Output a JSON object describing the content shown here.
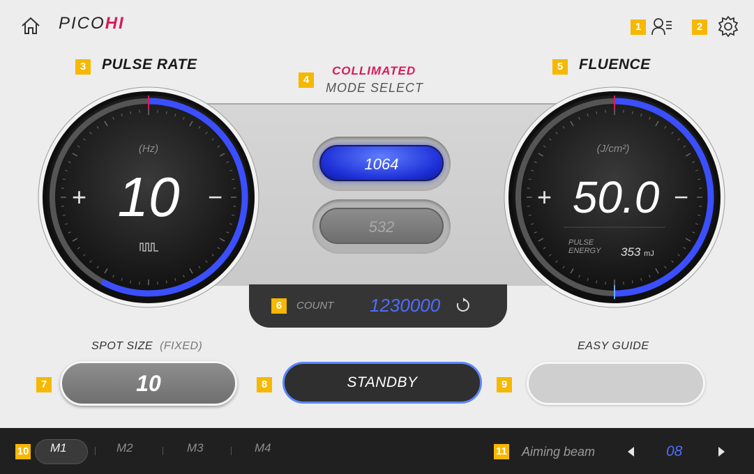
{
  "header": {
    "logo_main": "PICO",
    "logo_accent": "HI",
    "icons": [
      "home-icon",
      "user-list-icon",
      "gear-icon"
    ]
  },
  "badges": [
    "1",
    "2",
    "3",
    "4",
    "5",
    "6",
    "7",
    "8",
    "9",
    "10",
    "11"
  ],
  "pulse_rate": {
    "title": "PULSE RATE",
    "unit": "(Hz)",
    "value": "10",
    "plus": "+",
    "minus": "−",
    "icon": "pulse-wave-icon",
    "level_fraction": 0.58
  },
  "mode_select": {
    "title_top": "COLLIMATED",
    "title_bottom": "MODE SELECT",
    "wavelengths": [
      {
        "label": "1064",
        "active": true
      },
      {
        "label": "532",
        "active": false
      }
    ]
  },
  "fluence": {
    "title": "FLUENCE",
    "unit": "(J/cm²)",
    "value": "50.0",
    "plus": "+",
    "minus": "−",
    "pulse_energy_label_1": "PULSE",
    "pulse_energy_label_2": "ENERGY",
    "pulse_energy_value": "353",
    "pulse_energy_unit": "mJ",
    "level_fraction": 0.5
  },
  "count": {
    "label": "COUNT",
    "value": "1230000",
    "icon": "refresh-icon"
  },
  "spot_size": {
    "label": "SPOT SIZE",
    "fixed_label": "(FIXED)",
    "value": "10"
  },
  "standby": {
    "label": "STANDBY"
  },
  "easy_guide": {
    "label": "EASY GUIDE"
  },
  "memory_tabs": [
    {
      "label": "M1",
      "active": true
    },
    {
      "label": "M2",
      "active": false
    },
    {
      "label": "M3",
      "active": false
    },
    {
      "label": "M4",
      "active": false
    }
  ],
  "aiming_beam": {
    "label": "Aiming beam",
    "value": "08"
  },
  "colors": {
    "accent_blue": "#4f6cff",
    "brand_pink": "#d81b5a",
    "badge_yellow": "#f6b800"
  }
}
